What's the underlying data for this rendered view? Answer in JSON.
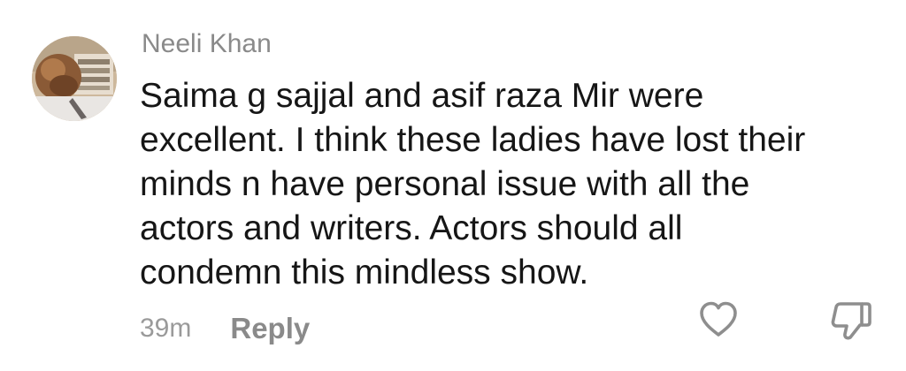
{
  "comment": {
    "username": "Neeli Khan",
    "text_lines": [
      "Saima g sajjal and asif raza Mir were",
      "excellent. I think these ladies have lost their",
      "minds n have personal issue with all the",
      "actors and writers. Actors should all",
      "condemn this mindless show."
    ],
    "timestamp": "39m",
    "reply_label": "Reply",
    "like_icon": "heart-outline-icon",
    "dislike_icon": "thumbs-down-outline-icon"
  }
}
